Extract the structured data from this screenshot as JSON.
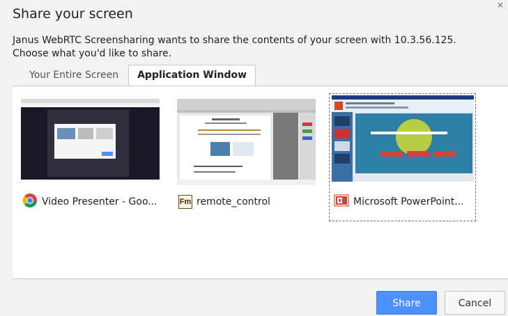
{
  "dialog": {
    "title": "Share your screen",
    "description": "Janus WebRTC Screensharing wants to share the contents of your screen with 10.3.56.125. Choose what you'd like to share.",
    "close_glyph": "×"
  },
  "tabs": [
    {
      "label": "Your Entire Screen",
      "active": false
    },
    {
      "label": "Application Window",
      "active": true
    }
  ],
  "windows": [
    {
      "label": "Video Presenter - Goo...",
      "icon": "chrome-icon",
      "selected": false
    },
    {
      "label": "remote_control",
      "icon": "framemaker-icon",
      "icon_text": "Fm",
      "selected": false
    },
    {
      "label": "Microsoft PowerPoint...",
      "icon": "powerpoint-icon",
      "selected": true
    }
  ],
  "buttons": {
    "share": "Share",
    "cancel": "Cancel"
  },
  "colors": {
    "accent": "#4d90fe",
    "dialog_bg": "#f2f2f2",
    "panel_bg": "#ffffff"
  }
}
